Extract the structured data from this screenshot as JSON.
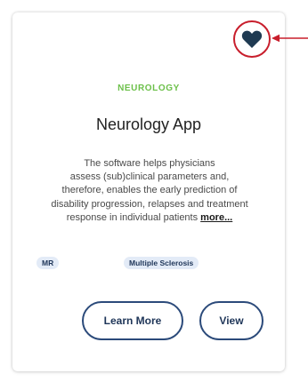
{
  "card": {
    "category": "NEUROLOGY",
    "title": "Neurology App",
    "description_lines": [
      "The software helps physicians",
      "assess (sub)clinical parameters and,",
      "therefore, enables the early prediction of",
      "disability progression, relapses and treatment",
      "response in individual patients"
    ],
    "more_label": "more...",
    "tags": [
      "MR",
      "Multiple Sclerosis"
    ],
    "buttons": {
      "learn_more": "Learn More",
      "view": "View"
    },
    "favorite_icon": "heart-icon"
  },
  "annotation": {
    "circle_color": "#c81e2c",
    "arrow_color": "#c81e2c"
  },
  "colors": {
    "category": "#6cc04a",
    "heart": "#1f3a52",
    "button_border": "#2b4a7a",
    "tag_background": "#e3ebf7"
  }
}
